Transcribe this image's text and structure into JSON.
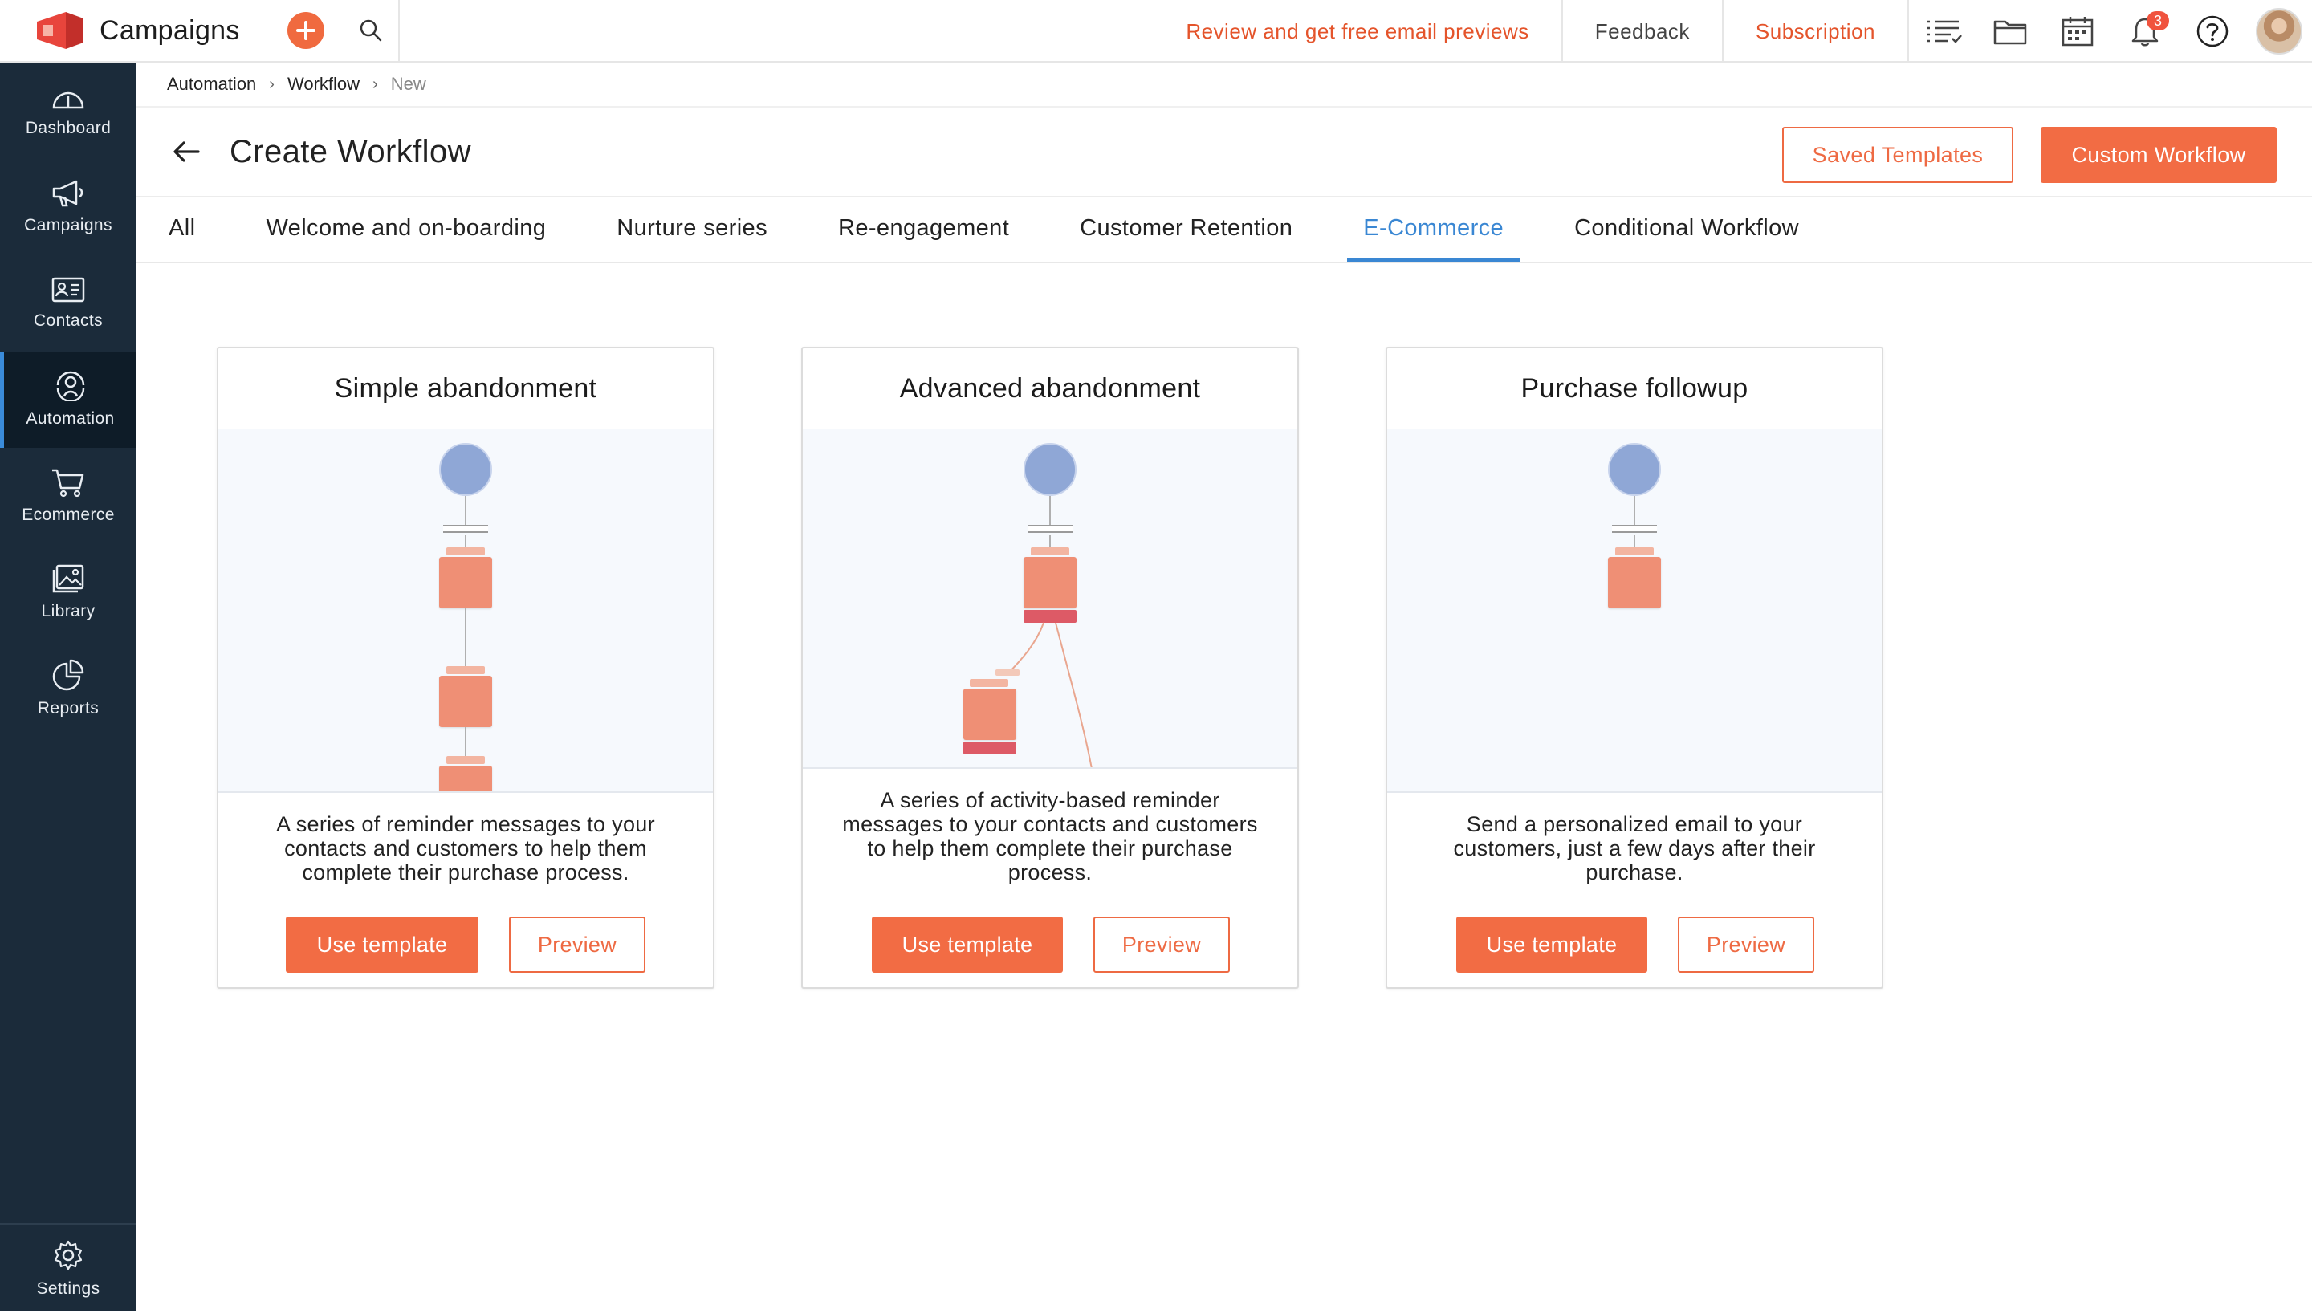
{
  "app": {
    "name": "Campaigns",
    "accent_color": "#f26c44",
    "sidebar_color": "#1b2b3a",
    "active_tab_color": "#3a87d3"
  },
  "topbar": {
    "review_link": "Review and get free email previews",
    "feedback": "Feedback",
    "subscription": "Subscription",
    "notification_count": "3",
    "icons": [
      "plus-icon",
      "search-icon",
      "list-icon",
      "folder-icon",
      "calendar-icon",
      "bell-icon",
      "help-icon"
    ]
  },
  "sidebar": {
    "items": [
      {
        "label": "Dashboard",
        "icon": "dashboard-icon"
      },
      {
        "label": "Campaigns",
        "icon": "megaphone-icon"
      },
      {
        "label": "Contacts",
        "icon": "contacts-icon"
      },
      {
        "label": "Automation",
        "icon": "automation-icon",
        "active": true
      },
      {
        "label": "Ecommerce",
        "icon": "cart-icon"
      },
      {
        "label": "Library",
        "icon": "image-icon"
      },
      {
        "label": "Reports",
        "icon": "pie-chart-icon"
      }
    ],
    "settings": "Settings"
  },
  "breadcrumb": [
    "Automation",
    "Workflow",
    "New"
  ],
  "page": {
    "title": "Create Workflow",
    "saved_templates": "Saved Templates",
    "custom_workflow": "Custom Workflow"
  },
  "tabs": [
    "All",
    "Welcome and on-boarding",
    "Nurture series",
    "Re-engagement",
    "Customer Retention",
    "E-Commerce",
    "Conditional Workflow"
  ],
  "active_tab": "E-Commerce",
  "cards": [
    {
      "title": "Simple abandonment",
      "description": "A series of reminder messages to your contacts and customers to help them complete their purchase process.",
      "use_label": "Use template",
      "preview_label": "Preview"
    },
    {
      "title": "Advanced abandonment",
      "description": "A series of activity-based reminder messages to your contacts and customers to help them complete their purchase process.",
      "use_label": "Use template",
      "preview_label": "Preview"
    },
    {
      "title": "Purchase followup",
      "description": "Send a personalized email to your customers, just a few days after their purchase.",
      "use_label": "Use template",
      "preview_label": "Preview"
    }
  ]
}
